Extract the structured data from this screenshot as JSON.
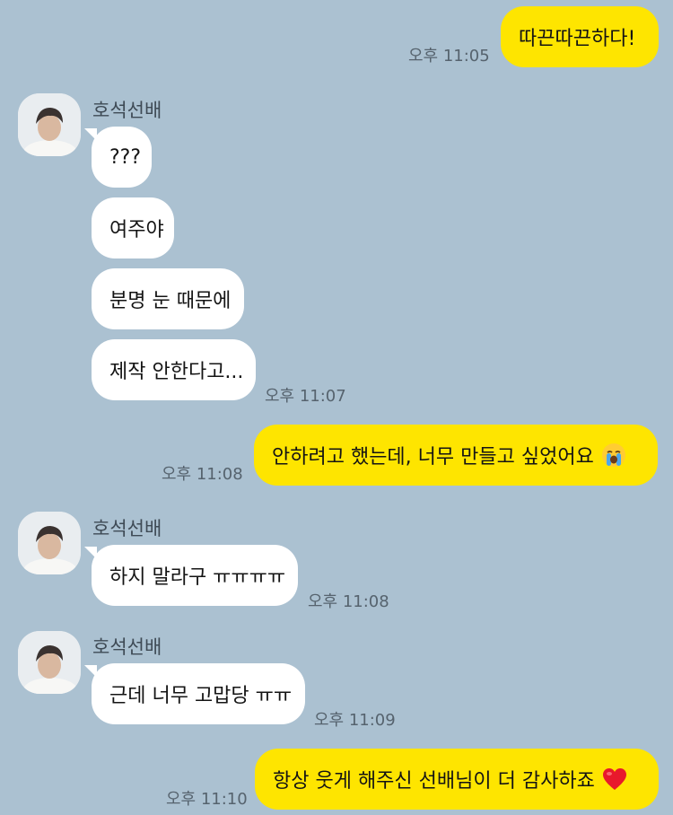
{
  "colors": {
    "background": "#abc1d1",
    "outgoing_bubble": "#fee500",
    "incoming_bubble": "#ffffff",
    "timestamp": "#56636e"
  },
  "contact": {
    "name": "호석선배",
    "avatar": "profile-photo"
  },
  "messages": [
    {
      "dir": "out",
      "text": "따끈따끈하다!",
      "time": "오후 11:05"
    },
    {
      "dir": "in",
      "sender": "호석선배",
      "text": "???"
    },
    {
      "dir": "in",
      "text": "여주야"
    },
    {
      "dir": "in",
      "text": "분명 눈 때문에"
    },
    {
      "dir": "in",
      "text": "제작 안한다고...",
      "time": "오후 11:07"
    },
    {
      "dir": "out",
      "text": "안하려고 했는데, 너무 만들고 싶었어요",
      "emoji": "loudly-crying-face",
      "time": "오후 11:08"
    },
    {
      "dir": "in",
      "sender": "호석선배",
      "text": "하지 말라구 ㅠㅠㅠㅠ",
      "time": "오후 11:08"
    },
    {
      "dir": "in",
      "sender": "호석선배",
      "text": "근데 너무 고맙당 ㅠㅠ",
      "time": "오후 11:09"
    },
    {
      "dir": "out",
      "text": "항상 웃게 해주신 선배님이 더 감사하죠",
      "emoji": "red-heart",
      "time": "오후 11:10"
    }
  ]
}
